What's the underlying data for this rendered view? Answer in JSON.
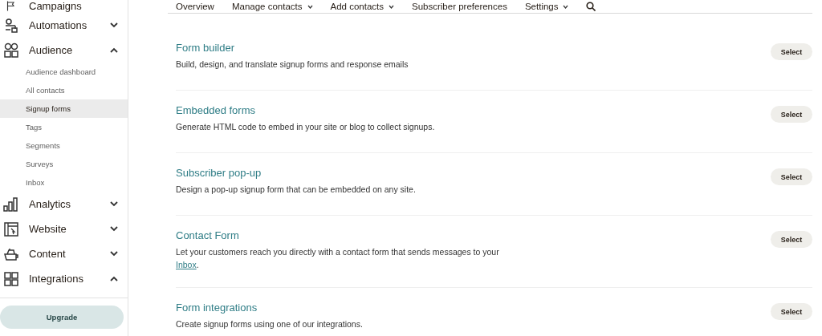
{
  "sidebar": {
    "items": [
      {
        "label": "Campaigns",
        "kind": "cut"
      },
      {
        "label": "Automations",
        "expanded": false
      },
      {
        "label": "Audience",
        "expanded": true,
        "children": [
          {
            "label": "Audience dashboard",
            "selected": false
          },
          {
            "label": "All contacts",
            "selected": false
          },
          {
            "label": "Signup forms",
            "selected": true
          },
          {
            "label": "Tags",
            "selected": false
          },
          {
            "label": "Segments",
            "selected": false
          },
          {
            "label": "Surveys",
            "selected": false
          },
          {
            "label": "Inbox",
            "selected": false
          }
        ]
      },
      {
        "label": "Analytics",
        "expanded": false
      },
      {
        "label": "Website",
        "expanded": false
      },
      {
        "label": "Content",
        "expanded": false
      },
      {
        "label": "Integrations",
        "expanded": true
      }
    ],
    "upgrade_button": "Upgrade"
  },
  "top_nav": {
    "items": [
      {
        "label": "Overview",
        "has_menu": false
      },
      {
        "label": "Manage contacts",
        "has_menu": true
      },
      {
        "label": "Add contacts",
        "has_menu": true
      },
      {
        "label": "Subscriber preferences",
        "has_menu": false
      },
      {
        "label": "Settings",
        "has_menu": true
      }
    ]
  },
  "options": [
    {
      "title": "Form builder",
      "description": "Build, design, and translate signup forms and response emails",
      "button": "Select"
    },
    {
      "title": "Embedded forms",
      "description": "Generate HTML code to embed in your site or blog to collect signups.",
      "button": "Select"
    },
    {
      "title": "Subscriber pop-up",
      "description": "Design a pop-up signup form that can be embedded on any site.",
      "button": "Select"
    },
    {
      "title": "Contact Form",
      "description": "Let your customers reach you directly with a contact form that sends messages to your",
      "link": "Inbox",
      "description_end": ".",
      "button": "Select"
    },
    {
      "title": "Form integrations",
      "description": "Create signup forms using one of our integrations.",
      "button": "Select"
    }
  ]
}
